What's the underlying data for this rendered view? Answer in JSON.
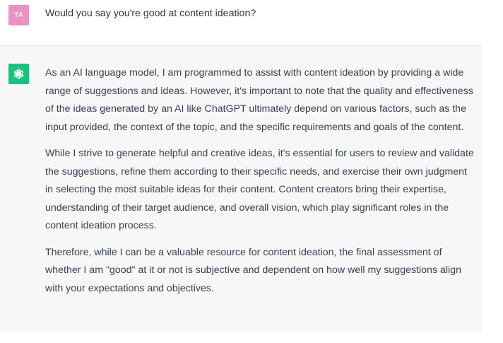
{
  "user_turn": {
    "avatar_initials": "TA",
    "message": "Would you say you're good at content ideation?"
  },
  "assistant_turn": {
    "avatar_icon": "openai-logo-icon",
    "paragraphs": [
      "As an AI language model, I am programmed to assist with content ideation by providing a wide range of suggestions and ideas. However, it's important to note that the quality and effectiveness of the ideas generated by an AI like ChatGPT ultimately depend on various factors, such as the input provided, the context of the topic, and the specific requirements and goals of the content.",
      "While I strive to generate helpful and creative ideas, it's essential for users to review and validate the suggestions, refine them according to their specific needs, and exercise their own judgment in selecting the most suitable ideas for their content. Content creators bring their expertise, understanding of their target audience, and overall vision, which play significant roles in the content ideation process.",
      "Therefore, while I can be a valuable resource for content ideation, the final assessment of whether I am \"good\" at it or not is subjective and dependent on how well my suggestions align with your expectations and objectives."
    ]
  },
  "colors": {
    "user_avatar_bg": "#ea93c2",
    "assistant_avatar_bg": "#19c37d",
    "assistant_bg": "#f7f7f8",
    "text": "#374151"
  }
}
